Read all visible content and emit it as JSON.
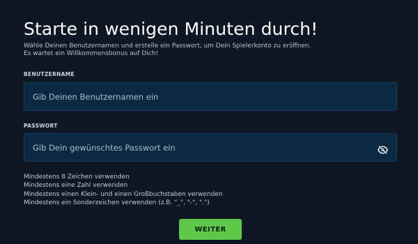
{
  "header": {
    "title": "Starte in wenigen Minuten durch!",
    "subtitle_line1": "Wähle Deinen Benutzernamen und erstelle ein Passwort, um Dein Spielerkonto zu eröffnen.",
    "subtitle_line2": "Es wartet ein Willkommensbonus auf Dich!"
  },
  "username": {
    "label": "BENUTZERNAME",
    "placeholder": "Gib Deinen Benutzernamen ein",
    "value": ""
  },
  "password": {
    "label": "PASSWORT",
    "placeholder": "Gib Dein gewünschtes Passwort ein",
    "value": "",
    "toggle_icon": "eye-slash-icon"
  },
  "rules": [
    "Mindestens 8 Zeichen verwenden",
    "Mindestens eine Zahl verwenden",
    "Mindestens einen Klein- und einen Großbuchstaben verwenden",
    "Mindestens ein Sonderzeichen verwenden (z.B. \"_\", \"-\", \".\")"
  ],
  "submit": {
    "label": "WEITER"
  },
  "colors": {
    "background": "#0f1724",
    "input_background": "#0a2a42",
    "input_border": "#173e5d",
    "button": "#5fc74a"
  }
}
